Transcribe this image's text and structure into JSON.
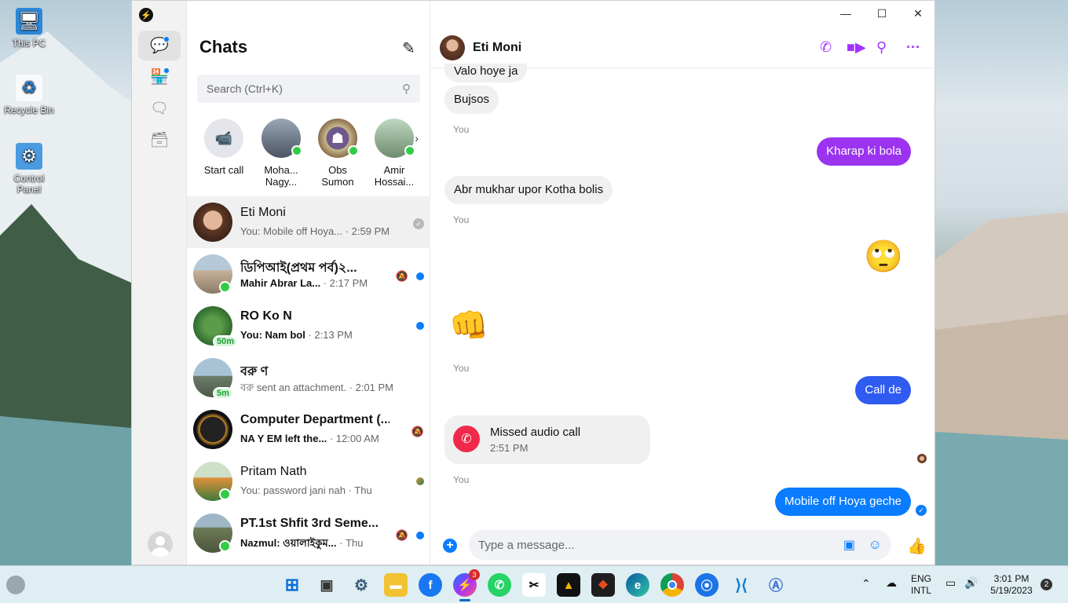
{
  "desktop": {
    "icons": [
      {
        "label": "This PC",
        "icon": "monitor-icon"
      },
      {
        "label": "Recycle Bin",
        "icon": "recycle-bin-icon"
      },
      {
        "label": "Control Panel",
        "icon": "control-panel-icon"
      }
    ]
  },
  "rail": {
    "items": [
      {
        "name": "chats",
        "icon": "chat-bubble-icon",
        "active": true,
        "has_dot": true
      },
      {
        "name": "marketplace",
        "icon": "store-icon",
        "has_dot": true
      },
      {
        "name": "requests",
        "icon": "message-request-icon"
      },
      {
        "name": "archive",
        "icon": "archive-icon"
      }
    ]
  },
  "chat_list": {
    "title": "Chats",
    "search_placeholder": "Search (Ctrl+K)",
    "stories": [
      {
        "label": "Start call",
        "icon": "video-call-icon"
      },
      {
        "label": "Moha...\nNagy...",
        "online": true
      },
      {
        "label": "Obs\nSumon",
        "online": true
      },
      {
        "label": "Amir\nHossai...",
        "online": true
      }
    ],
    "chats": [
      {
        "name": "Eti Moni",
        "preview": "You: Mobile off Hoya...",
        "time": "· 2:59 PM",
        "selected": true,
        "status": "seen"
      },
      {
        "name": "ডিপিআই(প্রথম পর্ব)২...",
        "sender": "Mahir Abrar La...",
        "time": "· 2:17 PM",
        "unread": true,
        "muted": true,
        "online": true
      },
      {
        "name": "RO Ko N",
        "sender": "You: Nam bol",
        "time": "· 2:13 PM",
        "unread": true,
        "active_ago": "50m"
      },
      {
        "name": "বরু ণ",
        "preview": "বরু sent an attachment.",
        "time": "· 2:01 PM",
        "active_ago": "5m"
      },
      {
        "name": "Computer Department (...",
        "sender": "NA Y EM left the...",
        "time": "· 12:00 AM",
        "muted": true
      },
      {
        "name": "Pritam Nath",
        "preview": "You: password jani nah",
        "time": "· Thu",
        "online": true,
        "status": "mini-avatar"
      },
      {
        "name": "PT.1st Shfit 3rd Seme...",
        "sender": "Nazmul: ওয়ালাইকুম...",
        "time": "· Thu",
        "unread": true,
        "muted": true,
        "online": true
      }
    ]
  },
  "conversation": {
    "contact_name": "Eti Moni",
    "header_icons": [
      "phone-icon",
      "video-icon",
      "search-icon",
      "more-icon"
    ],
    "messages": [
      {
        "type": "in",
        "text": "Valo hoye ja"
      },
      {
        "type": "in",
        "text": "Bujsos"
      },
      {
        "type": "you",
        "text": "You"
      },
      {
        "type": "out",
        "text": "Kharap ki bola",
        "color": "#9b33f0"
      },
      {
        "type": "in",
        "text": "Abr mukhar upor Kotha bolis"
      },
      {
        "type": "you",
        "text": "You"
      },
      {
        "type": "emoji-out",
        "text": "🙄"
      },
      {
        "type": "emoji-in",
        "text": "👊"
      },
      {
        "type": "you",
        "text": "You"
      },
      {
        "type": "out",
        "text": "Call de",
        "color": "#2f5bf0"
      },
      {
        "type": "call",
        "title": "Missed audio call",
        "time": "2:51 PM"
      },
      {
        "type": "you",
        "text": "You"
      },
      {
        "type": "out",
        "text": "Mobile off Hoya geche",
        "color": "#0a7cff"
      }
    ],
    "composer_placeholder": "Type a message..."
  },
  "window_controls": {
    "minimize": "—",
    "maximize": "☐",
    "close": "✕"
  },
  "taskbar": {
    "apps": [
      "start",
      "task-view",
      "settings",
      "file-explorer",
      "facebook",
      "messenger",
      "whatsapp",
      "capcut",
      "affinity",
      "figma",
      "edge",
      "chrome",
      "maps",
      "vscode",
      "app-store"
    ],
    "messenger_badge": "3",
    "lang1": "ENG",
    "lang2": "INTL",
    "time": "3:01 PM",
    "date": "5/19/2023",
    "notifications": "2"
  }
}
